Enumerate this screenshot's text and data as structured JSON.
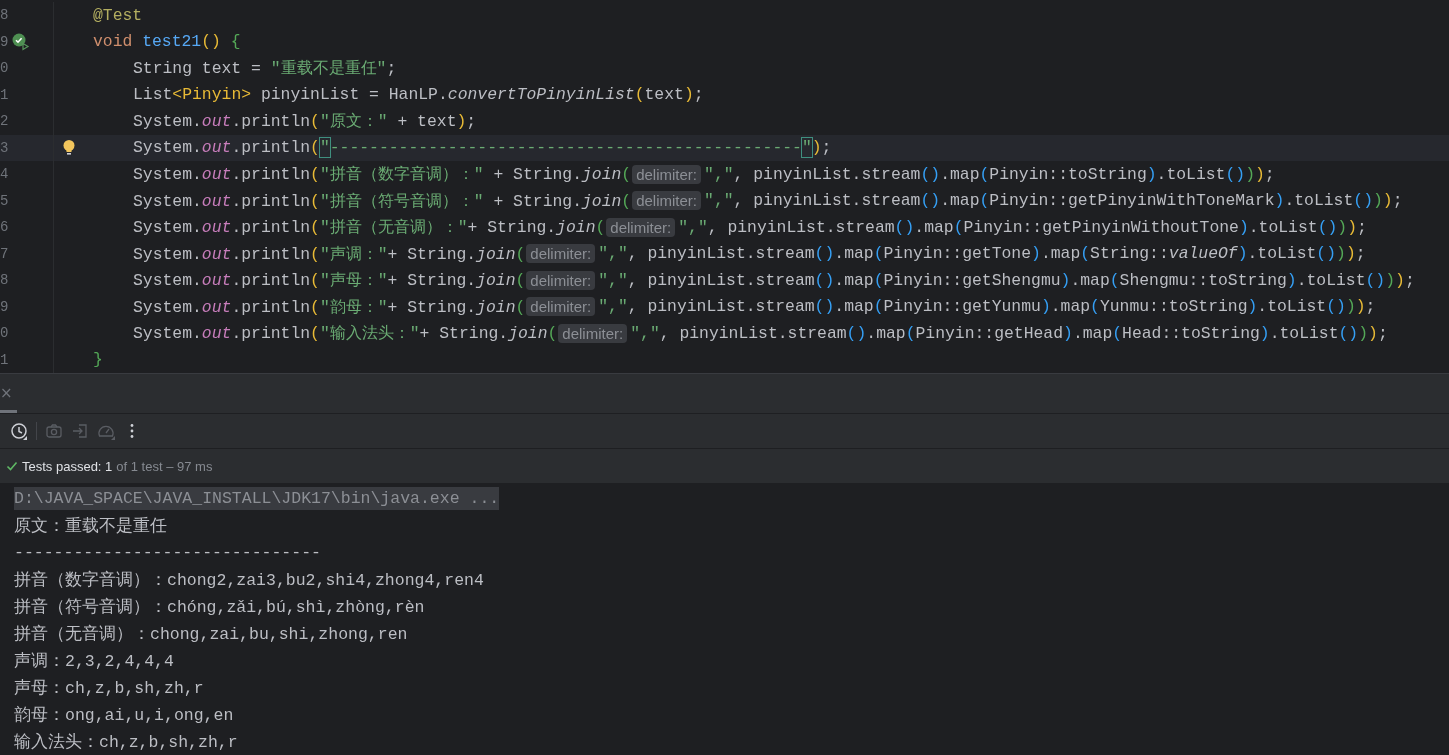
{
  "editor": {
    "lines": [
      {
        "number": "8",
        "kind": "member",
        "current": false,
        "run_icon": false,
        "bulb": false,
        "tokens": [
          {
            "kind": "ann",
            "text": "@Test"
          }
        ]
      },
      {
        "number": "9",
        "kind": "member",
        "current": false,
        "run_icon": true,
        "bulb": false,
        "tokens": [
          {
            "kind": "kw",
            "text": "void "
          },
          {
            "kind": "fn",
            "text": "test21"
          },
          {
            "kind": "p0",
            "text": "()"
          },
          {
            "kind": "p1",
            "text": " {"
          }
        ]
      },
      {
        "number": "0",
        "kind": "body",
        "current": false,
        "run_icon": false,
        "bulb": false,
        "tokens": [
          {
            "kind": "plain",
            "text": "String text = "
          },
          {
            "kind": "str",
            "text": "\"重载不是重任\""
          },
          {
            "kind": "plain",
            "text": ";"
          }
        ]
      },
      {
        "number": "1",
        "kind": "body",
        "current": false,
        "run_icon": false,
        "bulb": false,
        "tokens": [
          {
            "kind": "plain",
            "text": "List"
          },
          {
            "kind": "p0",
            "text": "<Pinyin>"
          },
          {
            "kind": "plain",
            "text": " pinyinList = HanLP."
          },
          {
            "kind": "italic",
            "text": "convertToPinyinList"
          },
          {
            "kind": "p0",
            "text": "("
          },
          {
            "kind": "plain",
            "text": "text"
          },
          {
            "kind": "p0",
            "text": ")"
          },
          {
            "kind": "plain",
            "text": ";"
          }
        ]
      },
      {
        "number": "2",
        "kind": "body",
        "current": false,
        "run_icon": false,
        "bulb": false,
        "tokens": [
          {
            "kind": "plain",
            "text": "System."
          },
          {
            "kind": "static",
            "text": "out"
          },
          {
            "kind": "plain",
            "text": ".println"
          },
          {
            "kind": "p0",
            "text": "("
          },
          {
            "kind": "str",
            "text": "\"原文：\""
          },
          {
            "kind": "plain",
            "text": " + text"
          },
          {
            "kind": "p0",
            "text": ")"
          },
          {
            "kind": "plain",
            "text": ";"
          }
        ]
      },
      {
        "number": "3",
        "kind": "body",
        "current": true,
        "run_icon": false,
        "bulb": true,
        "tokens": [
          {
            "kind": "plain",
            "text": "System."
          },
          {
            "kind": "static",
            "text": "out"
          },
          {
            "kind": "plain",
            "text": ".println"
          },
          {
            "kind": "p0",
            "text": "("
          },
          {
            "kind": "match",
            "text": "\""
          },
          {
            "kind": "str",
            "text": "------------------------------------------------"
          },
          {
            "kind": "match",
            "text": "\""
          },
          {
            "kind": "p0",
            "text": ")"
          },
          {
            "kind": "plain",
            "text": ";"
          }
        ]
      },
      {
        "number": "4",
        "kind": "body",
        "current": false,
        "run_icon": false,
        "bulb": false,
        "tokens": [
          {
            "kind": "plain",
            "text": "System."
          },
          {
            "kind": "static",
            "text": "out"
          },
          {
            "kind": "plain",
            "text": ".println"
          },
          {
            "kind": "p0",
            "text": "("
          },
          {
            "kind": "str",
            "text": "\"拼音（数字音调）：\""
          },
          {
            "kind": "plain",
            "text": " + String."
          },
          {
            "kind": "italic",
            "text": "join"
          },
          {
            "kind": "p1",
            "text": "("
          },
          {
            "kind": "hint",
            "text": "delimiter:"
          },
          {
            "kind": "str",
            "text": "\",\""
          },
          {
            "kind": "plain",
            "text": ", pinyinList.stream"
          },
          {
            "kind": "p2",
            "text": "()"
          },
          {
            "kind": "plain",
            "text": ".map"
          },
          {
            "kind": "p2",
            "text": "("
          },
          {
            "kind": "plain",
            "text": "Pinyin::toString"
          },
          {
            "kind": "p2",
            "text": ")"
          },
          {
            "kind": "plain",
            "text": ".toList"
          },
          {
            "kind": "p2",
            "text": "()"
          },
          {
            "kind": "p1",
            "text": ")"
          },
          {
            "kind": "p0",
            "text": ")"
          },
          {
            "kind": "plain",
            "text": ";"
          }
        ]
      },
      {
        "number": "5",
        "kind": "body",
        "current": false,
        "run_icon": false,
        "bulb": false,
        "tokens": [
          {
            "kind": "plain",
            "text": "System."
          },
          {
            "kind": "static",
            "text": "out"
          },
          {
            "kind": "plain",
            "text": ".println"
          },
          {
            "kind": "p0",
            "text": "("
          },
          {
            "kind": "str",
            "text": "\"拼音（符号音调）：\""
          },
          {
            "kind": "plain",
            "text": " + String."
          },
          {
            "kind": "italic",
            "text": "join"
          },
          {
            "kind": "p1",
            "text": "("
          },
          {
            "kind": "hint",
            "text": "delimiter:"
          },
          {
            "kind": "str",
            "text": "\",\""
          },
          {
            "kind": "plain",
            "text": ", pinyinList.stream"
          },
          {
            "kind": "p2",
            "text": "()"
          },
          {
            "kind": "plain",
            "text": ".map"
          },
          {
            "kind": "p2",
            "text": "("
          },
          {
            "kind": "plain",
            "text": "Pinyin::getPinyinWithToneMark"
          },
          {
            "kind": "p2",
            "text": ")"
          },
          {
            "kind": "plain",
            "text": ".toList"
          },
          {
            "kind": "p2",
            "text": "()"
          },
          {
            "kind": "p1",
            "text": ")"
          },
          {
            "kind": "p0",
            "text": ")"
          },
          {
            "kind": "plain",
            "text": ";"
          }
        ]
      },
      {
        "number": "6",
        "kind": "body",
        "current": false,
        "run_icon": false,
        "bulb": false,
        "tokens": [
          {
            "kind": "plain",
            "text": "System."
          },
          {
            "kind": "static",
            "text": "out"
          },
          {
            "kind": "plain",
            "text": ".println"
          },
          {
            "kind": "p0",
            "text": "("
          },
          {
            "kind": "str",
            "text": "\"拼音（无音调）：\""
          },
          {
            "kind": "plain",
            "text": "+ String."
          },
          {
            "kind": "italic",
            "text": "join"
          },
          {
            "kind": "p1",
            "text": "("
          },
          {
            "kind": "hint",
            "text": "delimiter:"
          },
          {
            "kind": "str",
            "text": "\",\""
          },
          {
            "kind": "plain",
            "text": ", pinyinList.stream"
          },
          {
            "kind": "p2",
            "text": "()"
          },
          {
            "kind": "plain",
            "text": ".map"
          },
          {
            "kind": "p2",
            "text": "("
          },
          {
            "kind": "plain",
            "text": "Pinyin::getPinyinWithoutTone"
          },
          {
            "kind": "p2",
            "text": ")"
          },
          {
            "kind": "plain",
            "text": ".toList"
          },
          {
            "kind": "p2",
            "text": "()"
          },
          {
            "kind": "p1",
            "text": ")"
          },
          {
            "kind": "p0",
            "text": ")"
          },
          {
            "kind": "plain",
            "text": ";"
          }
        ]
      },
      {
        "number": "7",
        "kind": "body",
        "current": false,
        "run_icon": false,
        "bulb": false,
        "tokens": [
          {
            "kind": "plain",
            "text": "System."
          },
          {
            "kind": "static",
            "text": "out"
          },
          {
            "kind": "plain",
            "text": ".println"
          },
          {
            "kind": "p0",
            "text": "("
          },
          {
            "kind": "str",
            "text": "\"声调：\""
          },
          {
            "kind": "plain",
            "text": "+ String."
          },
          {
            "kind": "italic",
            "text": "join"
          },
          {
            "kind": "p1",
            "text": "("
          },
          {
            "kind": "hint",
            "text": "delimiter:"
          },
          {
            "kind": "str",
            "text": "\",\""
          },
          {
            "kind": "plain",
            "text": ", pinyinList.stream"
          },
          {
            "kind": "p2",
            "text": "()"
          },
          {
            "kind": "plain",
            "text": ".map"
          },
          {
            "kind": "p2",
            "text": "("
          },
          {
            "kind": "plain",
            "text": "Pinyin::getTone"
          },
          {
            "kind": "p2",
            "text": ")"
          },
          {
            "kind": "plain",
            "text": ".map"
          },
          {
            "kind": "p2",
            "text": "("
          },
          {
            "kind": "plain",
            "text": "String::"
          },
          {
            "kind": "italic",
            "text": "valueOf"
          },
          {
            "kind": "p2",
            "text": ")"
          },
          {
            "kind": "plain",
            "text": ".toList"
          },
          {
            "kind": "p2",
            "text": "()"
          },
          {
            "kind": "p1",
            "text": ")"
          },
          {
            "kind": "p0",
            "text": ")"
          },
          {
            "kind": "plain",
            "text": ";"
          }
        ]
      },
      {
        "number": "8",
        "kind": "body",
        "current": false,
        "run_icon": false,
        "bulb": false,
        "tokens": [
          {
            "kind": "plain",
            "text": "System."
          },
          {
            "kind": "static",
            "text": "out"
          },
          {
            "kind": "plain",
            "text": ".println"
          },
          {
            "kind": "p0",
            "text": "("
          },
          {
            "kind": "str",
            "text": "\"声母：\""
          },
          {
            "kind": "plain",
            "text": "+ String."
          },
          {
            "kind": "italic",
            "text": "join"
          },
          {
            "kind": "p1",
            "text": "("
          },
          {
            "kind": "hint",
            "text": "delimiter:"
          },
          {
            "kind": "str",
            "text": "\",\""
          },
          {
            "kind": "plain",
            "text": ", pinyinList.stream"
          },
          {
            "kind": "p2",
            "text": "()"
          },
          {
            "kind": "plain",
            "text": ".map"
          },
          {
            "kind": "p2",
            "text": "("
          },
          {
            "kind": "plain",
            "text": "Pinyin::getShengmu"
          },
          {
            "kind": "p2",
            "text": ")"
          },
          {
            "kind": "plain",
            "text": ".map"
          },
          {
            "kind": "p2",
            "text": "("
          },
          {
            "kind": "plain",
            "text": "Shengmu::toString"
          },
          {
            "kind": "p2",
            "text": ")"
          },
          {
            "kind": "plain",
            "text": ".toList"
          },
          {
            "kind": "p2",
            "text": "()"
          },
          {
            "kind": "p1",
            "text": ")"
          },
          {
            "kind": "p0",
            "text": ")"
          },
          {
            "kind": "plain",
            "text": ";"
          }
        ]
      },
      {
        "number": "9",
        "kind": "body",
        "current": false,
        "run_icon": false,
        "bulb": false,
        "tokens": [
          {
            "kind": "plain",
            "text": "System."
          },
          {
            "kind": "static",
            "text": "out"
          },
          {
            "kind": "plain",
            "text": ".println"
          },
          {
            "kind": "p0",
            "text": "("
          },
          {
            "kind": "str",
            "text": "\"韵母：\""
          },
          {
            "kind": "plain",
            "text": "+ String."
          },
          {
            "kind": "italic",
            "text": "join"
          },
          {
            "kind": "p1",
            "text": "("
          },
          {
            "kind": "hint",
            "text": "delimiter:"
          },
          {
            "kind": "str",
            "text": "\",\""
          },
          {
            "kind": "plain",
            "text": ", pinyinList.stream"
          },
          {
            "kind": "p2",
            "text": "()"
          },
          {
            "kind": "plain",
            "text": ".map"
          },
          {
            "kind": "p2",
            "text": "("
          },
          {
            "kind": "plain",
            "text": "Pinyin::getYunmu"
          },
          {
            "kind": "p2",
            "text": ")"
          },
          {
            "kind": "plain",
            "text": ".map"
          },
          {
            "kind": "p2",
            "text": "("
          },
          {
            "kind": "plain",
            "text": "Yunmu::toString"
          },
          {
            "kind": "p2",
            "text": ")"
          },
          {
            "kind": "plain",
            "text": ".toList"
          },
          {
            "kind": "p2",
            "text": "()"
          },
          {
            "kind": "p1",
            "text": ")"
          },
          {
            "kind": "p0",
            "text": ")"
          },
          {
            "kind": "plain",
            "text": ";"
          }
        ]
      },
      {
        "number": "0",
        "kind": "body",
        "current": false,
        "run_icon": false,
        "bulb": false,
        "tokens": [
          {
            "kind": "plain",
            "text": "System."
          },
          {
            "kind": "static",
            "text": "out"
          },
          {
            "kind": "plain",
            "text": ".println"
          },
          {
            "kind": "p0",
            "text": "("
          },
          {
            "kind": "str",
            "text": "\"输入法头：\""
          },
          {
            "kind": "plain",
            "text": "+ String."
          },
          {
            "kind": "italic",
            "text": "join"
          },
          {
            "kind": "p1",
            "text": "("
          },
          {
            "kind": "hint",
            "text": "delimiter:"
          },
          {
            "kind": "str",
            "text": "\",\""
          },
          {
            "kind": "plain",
            "text": ", pinyinList.stream"
          },
          {
            "kind": "p2",
            "text": "()"
          },
          {
            "kind": "plain",
            "text": ".map"
          },
          {
            "kind": "p2",
            "text": "("
          },
          {
            "kind": "plain",
            "text": "Pinyin::getHead"
          },
          {
            "kind": "p2",
            "text": ")"
          },
          {
            "kind": "plain",
            "text": ".map"
          },
          {
            "kind": "p2",
            "text": "("
          },
          {
            "kind": "plain",
            "text": "Head::toString"
          },
          {
            "kind": "p2",
            "text": ")"
          },
          {
            "kind": "plain",
            "text": ".toList"
          },
          {
            "kind": "p2",
            "text": "()"
          },
          {
            "kind": "p1",
            "text": ")"
          },
          {
            "kind": "p0",
            "text": ")"
          },
          {
            "kind": "plain",
            "text": ";"
          }
        ]
      },
      {
        "number": "1",
        "kind": "member",
        "current": false,
        "run_icon": false,
        "bulb": false,
        "tokens": [
          {
            "kind": "p1",
            "text": "}"
          }
        ]
      }
    ]
  },
  "panel": {
    "tab_close": "×",
    "toolbar": [
      {
        "kind": "history",
        "disabled": false
      },
      {
        "kind": "camera",
        "disabled": true
      },
      {
        "kind": "import",
        "disabled": true
      },
      {
        "kind": "gauge",
        "disabled": true
      },
      {
        "kind": "more",
        "disabled": false
      }
    ],
    "status": {
      "passed": true,
      "label": "Tests passed: 1",
      "detail": "of 1 test – 97 ms"
    },
    "console": [
      {
        "kind": "command",
        "text": "D:\\JAVA_SPACE\\JAVA_INSTALL\\JDK17\\bin\\java.exe ..."
      },
      {
        "kind": "output",
        "text": "原文：重载不是重任"
      },
      {
        "kind": "output",
        "text": "-------------------------------"
      },
      {
        "kind": "output",
        "text": "拼音（数字音调）：chong2,zai3,bu2,shi4,zhong4,ren4"
      },
      {
        "kind": "output",
        "text": "拼音（符号音调）：chóng,zǎi,bú,shì,zhòng,rèn"
      },
      {
        "kind": "output",
        "text": "拼音（无音调）：chong,zai,bu,shi,zhong,ren"
      },
      {
        "kind": "output",
        "text": "声调：2,3,2,4,4,4"
      },
      {
        "kind": "output",
        "text": "声母：ch,z,b,sh,zh,r"
      },
      {
        "kind": "output",
        "text": "韵母：ong,ai,u,i,ong,en"
      },
      {
        "kind": "output",
        "text": "输入法头：ch,z,b,sh,zh,r"
      }
    ]
  }
}
